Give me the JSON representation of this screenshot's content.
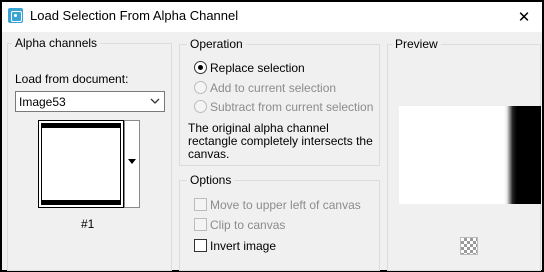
{
  "window": {
    "title": "Load Selection From Alpha Channel"
  },
  "alpha_channels": {
    "legend": "Alpha channels",
    "load_from_label": "Load from document:",
    "document_value": "Image53",
    "channel_caption": "#1"
  },
  "operation": {
    "legend": "Operation",
    "options": [
      {
        "label": "Replace selection",
        "selected": true,
        "enabled": true
      },
      {
        "label": "Add to current selection",
        "selected": false,
        "enabled": false
      },
      {
        "label": "Subtract from current selection",
        "selected": false,
        "enabled": false
      }
    ],
    "description_line1": "The original alpha channel",
    "description_line2": "rectangle completely intersects the",
    "description_line3": "canvas."
  },
  "options": {
    "legend": "Options",
    "items": [
      {
        "label": "Move to upper left of canvas",
        "checked": false,
        "enabled": false
      },
      {
        "label": "Clip to canvas",
        "checked": false,
        "enabled": false
      },
      {
        "label": "Invert image",
        "checked": false,
        "enabled": true
      }
    ]
  },
  "preview": {
    "legend": "Preview"
  },
  "icons": {
    "app": "selection-app-icon",
    "close": "close-icon",
    "dropdown": "chevron-down-icon",
    "channel_dropdown": "triangle-down-icon",
    "checker": "transparency-checker-icon"
  }
}
